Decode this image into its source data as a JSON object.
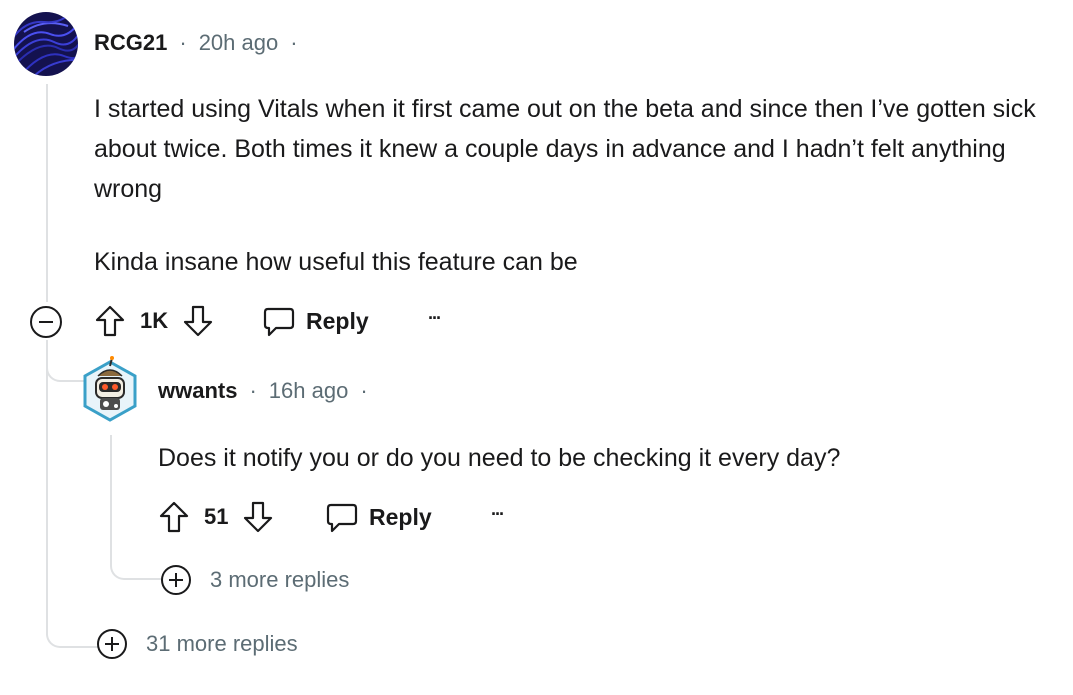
{
  "comment": {
    "author": "RCG21",
    "time": "20h ago",
    "separator": "·",
    "paragraphs": [
      "I started using Vitals when it first came out on the beta and since then I’ve gotten sick about twice. Both times it knew a couple days in advance and I hadn’t felt anything wrong",
      "Kinda insane how useful this feature can be"
    ],
    "score": "1K",
    "reply_label": "Reply",
    "more_label": "···",
    "more_replies": "31 more replies"
  },
  "reply": {
    "author": "wwants",
    "time": "16h ago",
    "separator": "·",
    "text": "Does it notify you or do you need to be checking it every day?",
    "score": "51",
    "reply_label": "Reply",
    "more_label": "···",
    "more_replies": "3 more replies"
  },
  "colors": {
    "text": "#1a1a1b",
    "meta": "#5c6c74",
    "thread_line": "#dfe1e3",
    "avatar1_bg": "#1c1a6e",
    "avatar2_ring": "#3aa0c8"
  },
  "icons": [
    "avatar-rcg21",
    "avatar-wwants",
    "collapse-icon",
    "upvote-icon",
    "downvote-icon",
    "reply-icon",
    "more-icon",
    "expand-icon"
  ]
}
